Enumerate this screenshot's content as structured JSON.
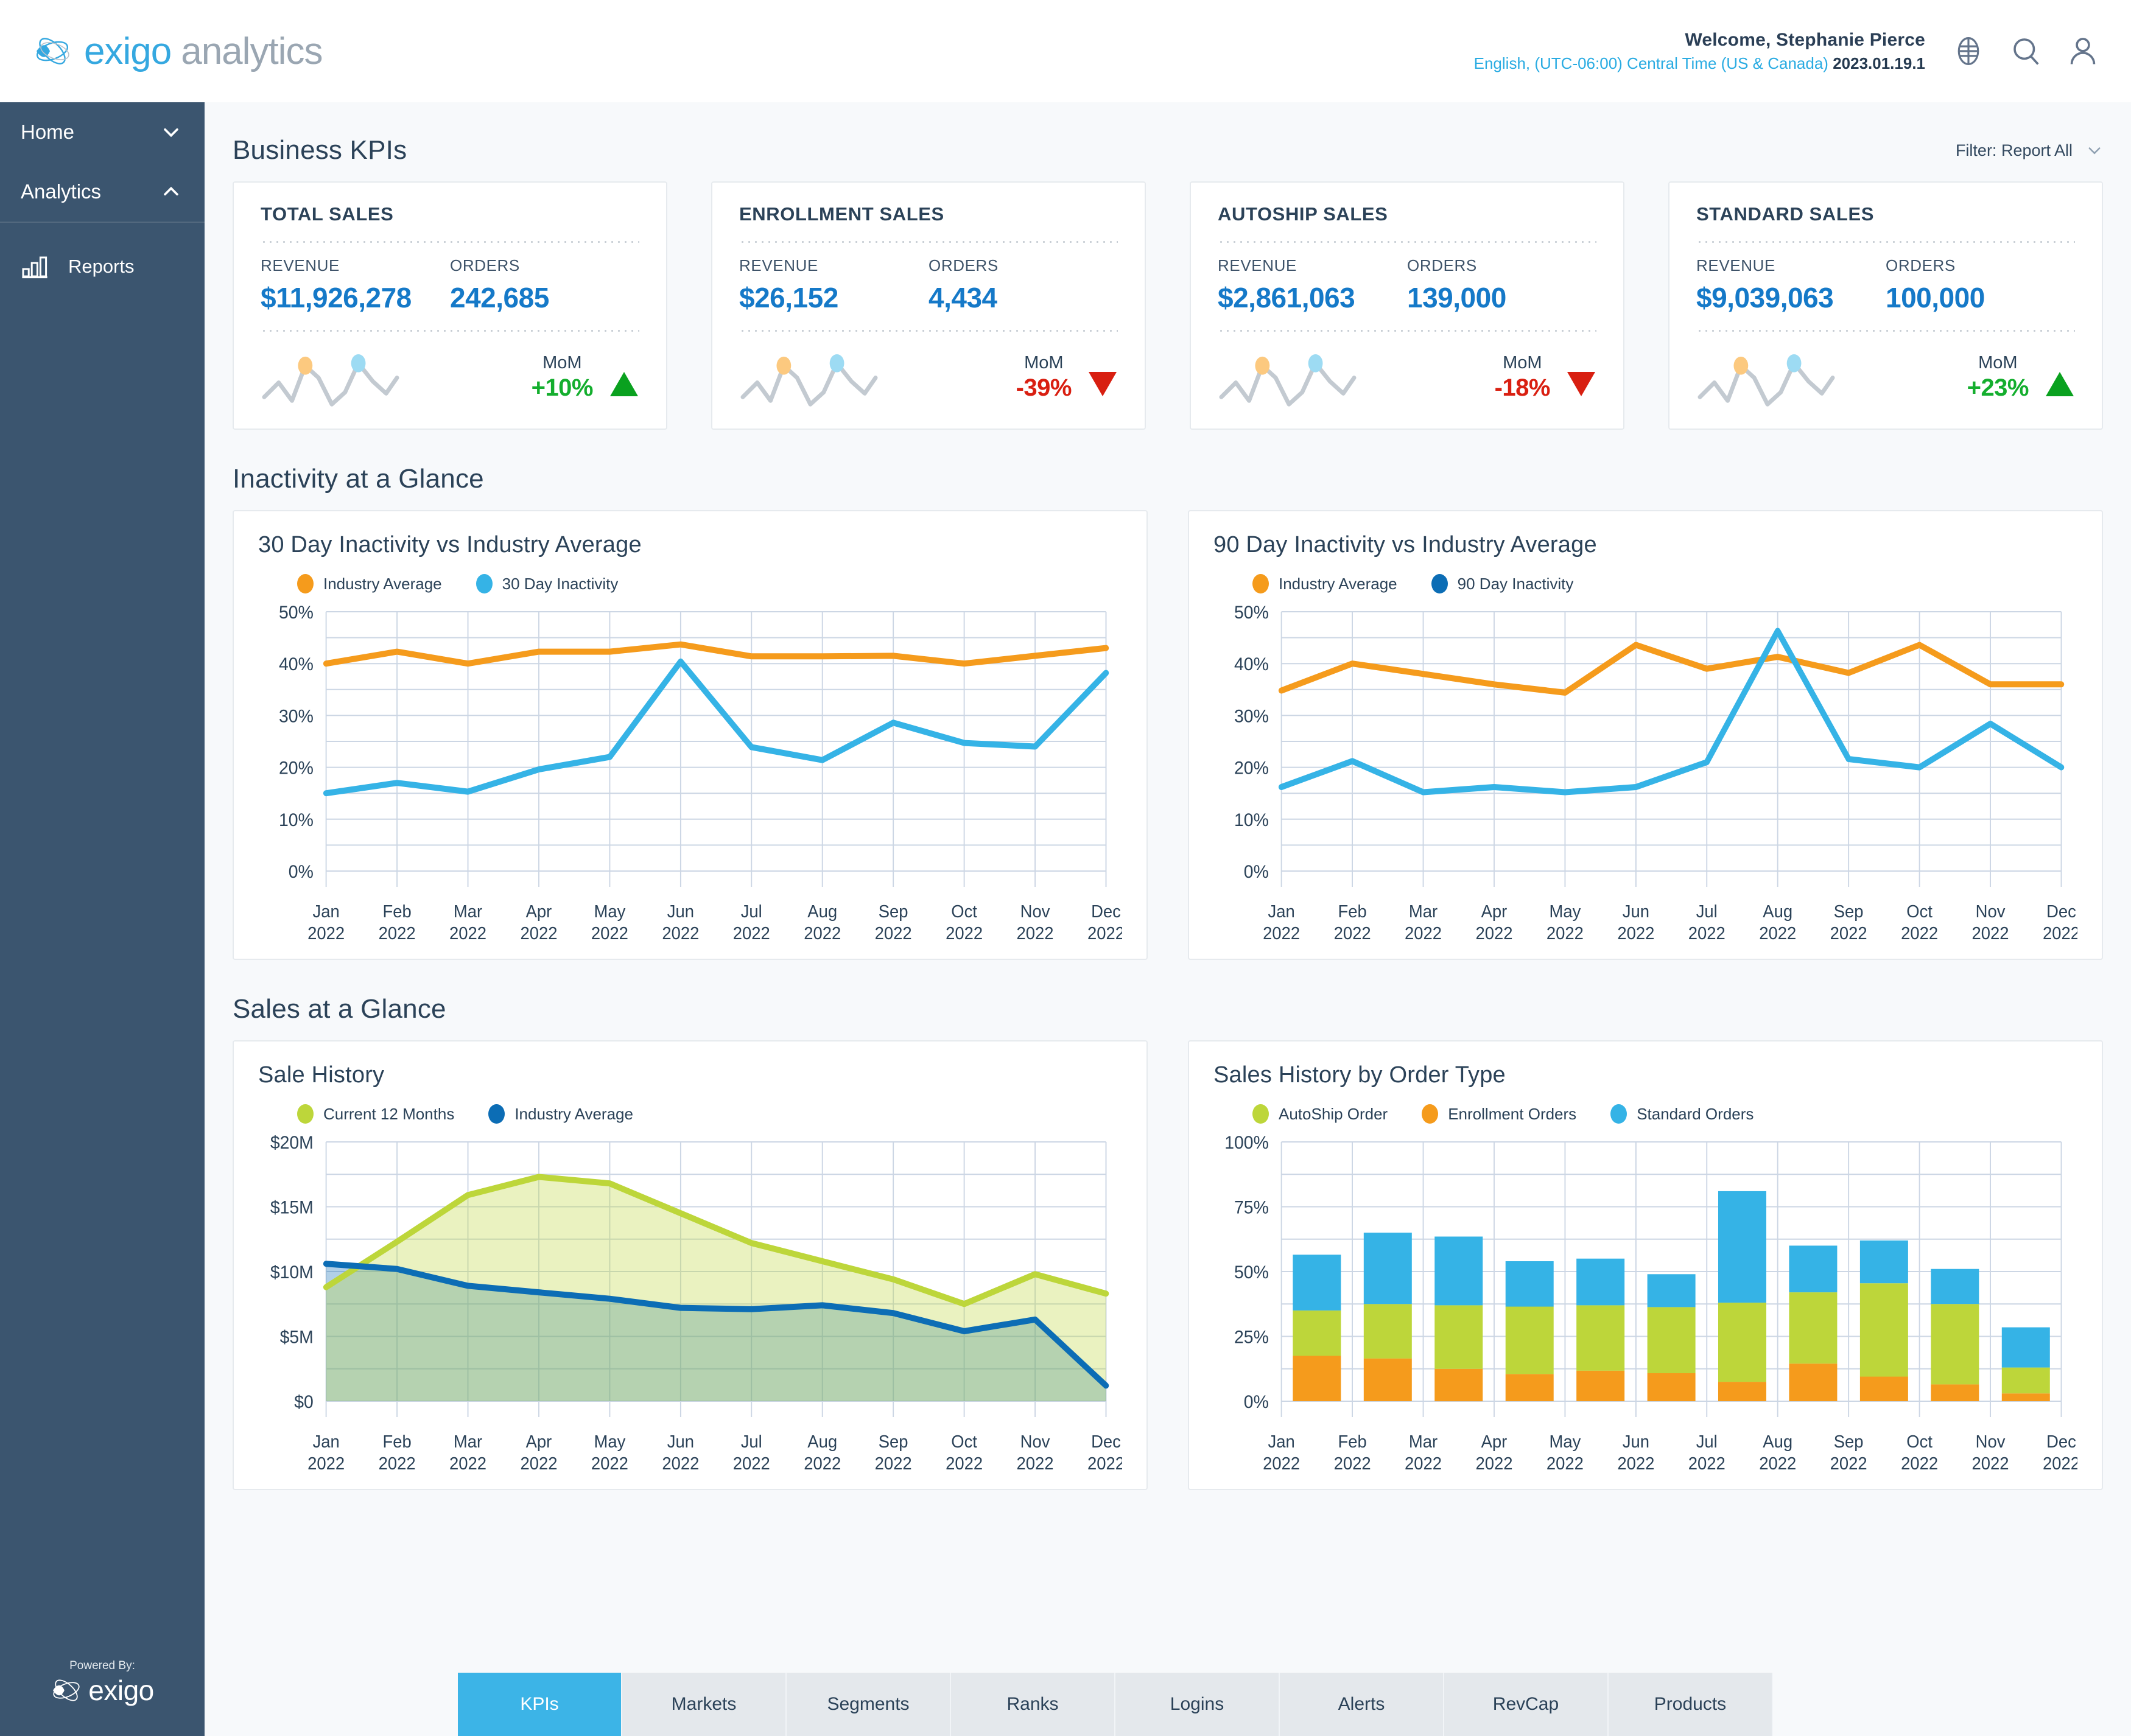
{
  "brand": {
    "name_1": "exigo",
    "name_2": "analytics"
  },
  "header": {
    "welcome": "Welcome, Stephanie Pierce",
    "locale": "English, (UTC-06:00) Central Time (US & Canada)",
    "version": "2023.01.19.1",
    "icons": [
      "globe-icon",
      "search-icon",
      "user-icon"
    ]
  },
  "sidebar": {
    "items": [
      {
        "label": "Home",
        "chev": "down"
      },
      {
        "label": "Analytics",
        "chev": "up"
      }
    ],
    "sub_items": [
      {
        "label": "Reports",
        "icon": "bar-chart-icon"
      }
    ],
    "powered_by_label": "Powered By:",
    "powered_by_name": "exigo"
  },
  "business_kpis": {
    "title": "Business KPIs",
    "filter_label": "Filter: Report All",
    "revenue_label": "REVENUE",
    "orders_label": "ORDERS",
    "mom_label": "MoM",
    "cards": [
      {
        "title": "TOTAL SALES",
        "revenue": "$11,926,278",
        "orders": "242,685",
        "mom": "+10%",
        "dir": "up"
      },
      {
        "title": "ENROLLMENT SALES",
        "revenue": "$26,152",
        "orders": "4,434",
        "mom": "-39%",
        "dir": "down"
      },
      {
        "title": "AUTOSHIP SALES",
        "revenue": "$2,861,063",
        "orders": "139,000",
        "mom": "-18%",
        "dir": "down"
      },
      {
        "title": "STANDARD SALES",
        "revenue": "$9,039,063",
        "orders": "100,000",
        "mom": "+23%",
        "dir": "up"
      }
    ]
  },
  "inactivity_section": {
    "title": "Inactivity at a Glance"
  },
  "sales_section": {
    "title": "Sales at a Glance"
  },
  "tabs": {
    "items": [
      "KPIs",
      "Markets",
      "Segments",
      "Ranks",
      "Logins",
      "Alerts",
      "RevCap",
      "Products"
    ],
    "active": "KPIs"
  },
  "colors": {
    "orange": "#f59b1c",
    "light_blue": "#35b3e6",
    "dark_blue": "#0c6db5",
    "green": "#bdd63a",
    "accent_blue": "#1579c8",
    "sidebar": "#3b556f",
    "up": "#14ae2e",
    "down": "#d91f11"
  },
  "chart_data": [
    {
      "type": "line",
      "id": "inactivity-30",
      "title": "30 Day Inactivity vs Industry Average",
      "categories": [
        "Jan 2022",
        "Feb 2022",
        "Mar 2022",
        "Apr 2022",
        "May 2022",
        "Jun 2022",
        "Jul 2022",
        "Aug 2022",
        "Sep 2022",
        "Oct 2022",
        "Nov 2022",
        "Dec 2022"
      ],
      "ylabel": "",
      "xlabel": "",
      "ylim": [
        0,
        50
      ],
      "yticks": [
        0,
        10,
        20,
        30,
        40,
        50
      ],
      "ytick_labels": [
        "0%",
        "10%",
        "20%",
        "30%",
        "40%",
        "50%"
      ],
      "grid": true,
      "legend_position": "top-left",
      "series": [
        {
          "name": "Industry Average",
          "color": "#f59b1c",
          "values": [
            40.0,
            42.3,
            40.0,
            42.3,
            42.3,
            43.7,
            41.4,
            41.4,
            41.5,
            40.0,
            41.5,
            43.0
          ]
        },
        {
          "name": "30 Day Inactivity",
          "color": "#35b3e6",
          "values": [
            15.0,
            17.0,
            15.3,
            19.6,
            22.0,
            40.4,
            23.9,
            21.4,
            28.6,
            24.7,
            24.0,
            38.2
          ]
        }
      ]
    },
    {
      "type": "line",
      "id": "inactivity-90",
      "title": "90 Day Inactivity vs Industry Average",
      "categories": [
        "Jan 2022",
        "Feb 2022",
        "Mar 2022",
        "Apr 2022",
        "May 2022",
        "Jun 2022",
        "Jul 2022",
        "Aug 2022",
        "Sep 2022",
        "Oct 2022",
        "Nov 2022",
        "Dec 2022"
      ],
      "ylabel": "",
      "xlabel": "",
      "ylim": [
        0,
        50
      ],
      "yticks": [
        0,
        10,
        20,
        30,
        40,
        50
      ],
      "ytick_labels": [
        "0%",
        "10%",
        "20%",
        "30%",
        "40%",
        "50%"
      ],
      "grid": true,
      "legend_position": "top-left",
      "series": [
        {
          "name": "Industry Average",
          "color": "#f59b1c",
          "values": [
            34.8,
            40.0,
            38.0,
            36.0,
            34.4,
            43.6,
            39.0,
            41.3,
            38.2,
            43.6,
            36.0,
            36.0
          ]
        },
        {
          "name": "90 Day Inactivity",
          "color": "#35b3e6",
          "values": [
            16.2,
            21.2,
            15.2,
            16.2,
            15.2,
            16.2,
            21.0,
            46.3,
            21.6,
            20.0,
            28.4,
            20.0
          ]
        }
      ]
    },
    {
      "type": "area",
      "id": "sale-history",
      "title": "Sale History",
      "categories": [
        "Jan 2022",
        "Feb 2022",
        "Mar 2022",
        "Apr 2022",
        "May 2022",
        "Jun 2022",
        "Jul 2022",
        "Aug 2022",
        "Sep 2022",
        "Oct 2022",
        "Nov 2022",
        "Dec 2022"
      ],
      "ylabel": "",
      "xlabel": "",
      "ylim": [
        0,
        20
      ],
      "yticks": [
        0,
        5,
        10,
        15,
        20
      ],
      "ytick_labels": [
        "$0",
        "$5M",
        "$10M",
        "$15M",
        "$20M"
      ],
      "grid": true,
      "legend_position": "top-left",
      "series": [
        {
          "name": "Current 12 Months",
          "color": "#bdd63a",
          "values": [
            8.8,
            12.3,
            15.9,
            17.3,
            16.8,
            14.5,
            12.2,
            10.8,
            9.4,
            7.5,
            9.8,
            8.3
          ]
        },
        {
          "name": "Industry Average",
          "color": "#0c6db5",
          "values": [
            10.6,
            10.2,
            8.9,
            8.4,
            7.9,
            7.2,
            7.1,
            7.4,
            6.8,
            5.4,
            6.3,
            1.2
          ]
        }
      ]
    },
    {
      "type": "bar",
      "id": "sales-by-order-type",
      "stacked": true,
      "title": "Sales History by Order Type",
      "categories": [
        "Jan 2022",
        "Feb 2022",
        "Mar 2022",
        "Apr 2022",
        "May 2022",
        "Jun 2022",
        "Jul 2022",
        "Aug 2022",
        "Sep 2022",
        "Oct 2022",
        "Nov 2022",
        "Dec 2022"
      ],
      "ylabel": "",
      "xlabel": "",
      "ylim": [
        0,
        100
      ],
      "yticks": [
        0,
        25,
        50,
        75,
        100
      ],
      "ytick_labels": [
        "0%",
        "25%",
        "50%",
        "75%",
        "100%"
      ],
      "grid": true,
      "legend_position": "top-left",
      "series": [
        {
          "name": "Enrollment Orders",
          "color": "#f59b1c",
          "values": [
            17.5,
            16.5,
            12.5,
            10.5,
            11.8,
            10.8,
            7.5,
            14.5,
            9.5,
            6.5,
            3.0,
            0
          ]
        },
        {
          "name": "AutoShip Order",
          "color": "#bdd63a",
          "values": [
            17.5,
            21.0,
            24.5,
            26.0,
            25.2,
            25.5,
            30.5,
            27.5,
            36.0,
            31.0,
            10.0,
            0
          ]
        },
        {
          "name": "Standard Orders",
          "color": "#35b3e6",
          "values": [
            21.5,
            27.5,
            26.5,
            17.5,
            18.0,
            12.7,
            43.0,
            18.0,
            16.5,
            13.5,
            15.5,
            0
          ]
        }
      ],
      "legend_order": [
        "AutoShip Order",
        "Enrollment Orders",
        "Standard Orders"
      ]
    }
  ]
}
